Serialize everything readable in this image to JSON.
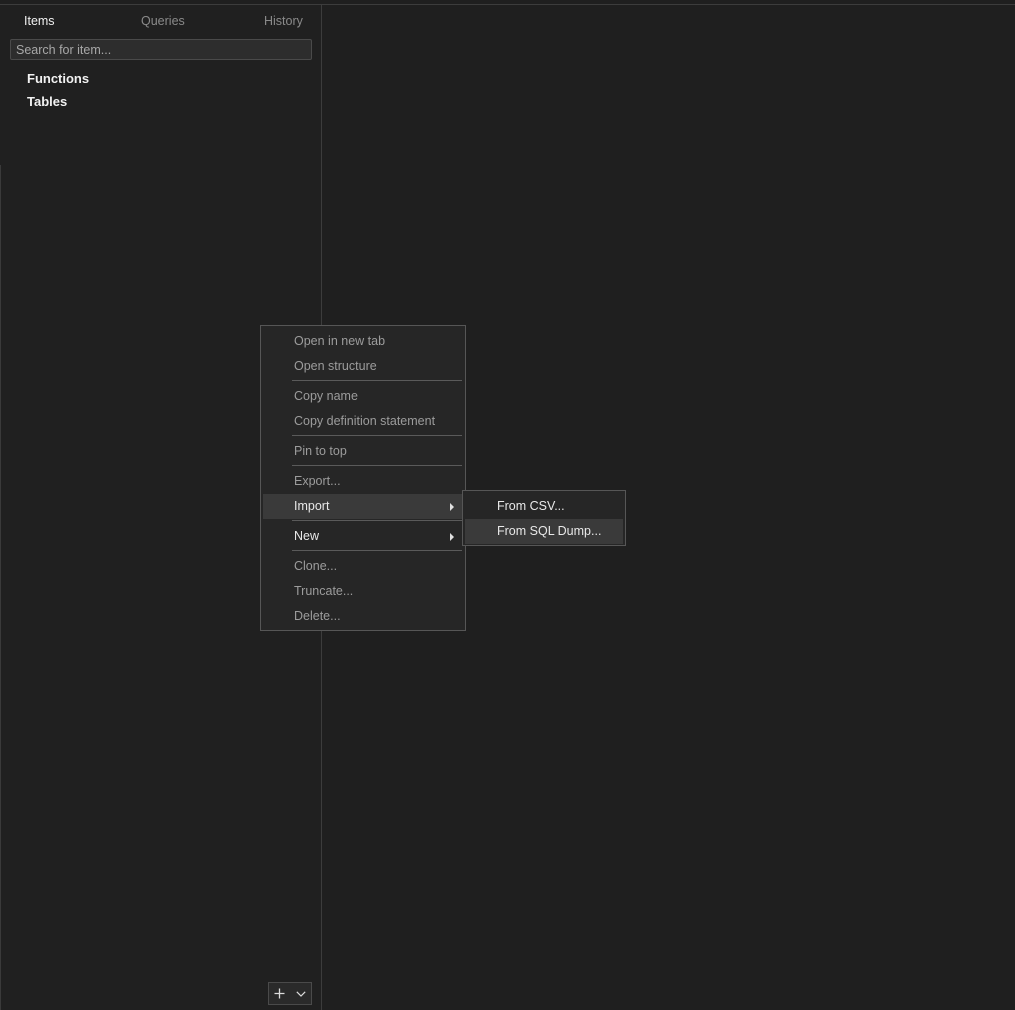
{
  "sidebar": {
    "tabs": [
      {
        "label": "Items",
        "active": true
      },
      {
        "label": "Queries",
        "active": false
      },
      {
        "label": "History",
        "active": false
      }
    ],
    "search_placeholder": "Search for item...",
    "tree": [
      {
        "label": "Functions"
      },
      {
        "label": "Tables"
      }
    ],
    "bottom_buttons": {
      "add_icon": "plus-icon",
      "dropdown_icon": "chevron-down-icon"
    }
  },
  "context_menu": {
    "items": [
      {
        "label": "Open in new tab",
        "enabled": false
      },
      {
        "label": "Open structure",
        "enabled": false
      },
      {
        "label": "Copy name",
        "enabled": false
      },
      {
        "label": "Copy definition statement",
        "enabled": false
      },
      {
        "label": "Pin to top",
        "enabled": false
      },
      {
        "label": "Export...",
        "enabled": false
      },
      {
        "label": "Import",
        "enabled": true,
        "submenu": true,
        "highlighted": true
      },
      {
        "label": "New",
        "enabled": true,
        "submenu": true
      },
      {
        "label": "Clone...",
        "enabled": false
      },
      {
        "label": "Truncate...",
        "enabled": false
      },
      {
        "label": "Delete...",
        "enabled": false
      }
    ]
  },
  "import_submenu": {
    "items": [
      {
        "label": "From CSV...",
        "enabled": true
      },
      {
        "label": "From SQL Dump...",
        "enabled": true,
        "highlighted": true
      }
    ]
  },
  "colors": {
    "background": "#1f1f1f",
    "menu_background": "#262626",
    "menu_highlight": "#3a3a3a",
    "text_enabled": "#e8e8e8",
    "text_disabled": "#9c9c9c"
  }
}
